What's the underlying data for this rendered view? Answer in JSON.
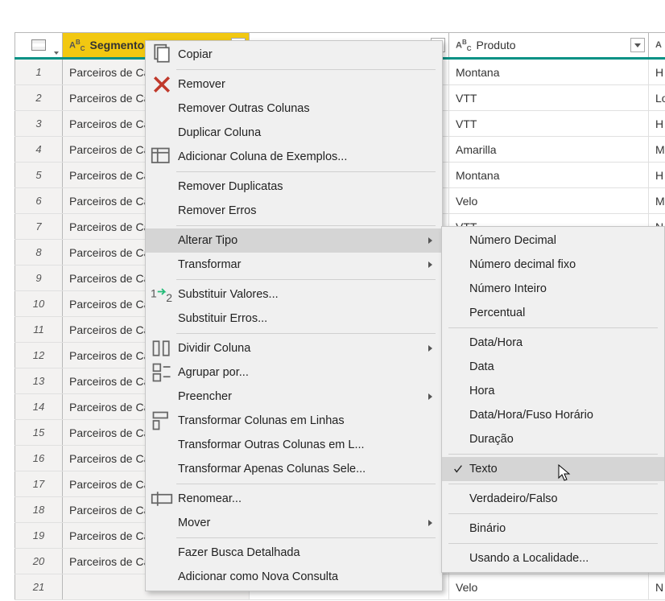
{
  "columns": {
    "segmento": {
      "label": "Segmento",
      "type_prefix": "A",
      "type_suffix": "B",
      "type_sub": "C"
    },
    "pais": {
      "label": "",
      "type_prefix": "A",
      "type_suffix": "B",
      "type_sub": "C"
    },
    "produto": {
      "label": "Produto",
      "type_prefix": "A",
      "type_suffix": "B",
      "type_sub": "C"
    },
    "extra": {
      "label": "",
      "type_prefix": "A"
    }
  },
  "rows": [
    {
      "n": "1",
      "segmento": "Parceiros de Can",
      "produto": "Montana",
      "extra": "H"
    },
    {
      "n": "2",
      "segmento": "Parceiros de Can",
      "produto": "VTT",
      "extra": "Lo"
    },
    {
      "n": "3",
      "segmento": "Parceiros de Can",
      "produto": "VTT",
      "extra": "H"
    },
    {
      "n": "4",
      "segmento": "Parceiros de Can",
      "produto": "Amarilla",
      "extra": "M"
    },
    {
      "n": "5",
      "segmento": "Parceiros de Can",
      "produto": "Montana",
      "extra": "H"
    },
    {
      "n": "6",
      "segmento": "Parceiros de Can",
      "produto": "Velo",
      "extra": "M"
    },
    {
      "n": "7",
      "segmento": "Parceiros de Can",
      "produto": "VTT",
      "extra": "N"
    },
    {
      "n": "8",
      "segmento": "Parceiros de Can",
      "produto": "",
      "extra": ""
    },
    {
      "n": "9",
      "segmento": "Parceiros de Can",
      "produto": "",
      "extra": ""
    },
    {
      "n": "10",
      "segmento": "Parceiros de Can",
      "produto": "",
      "extra": ""
    },
    {
      "n": "11",
      "segmento": "Parceiros de Can",
      "produto": "",
      "extra": ""
    },
    {
      "n": "12",
      "segmento": "Parceiros de Can",
      "produto": "",
      "extra": ""
    },
    {
      "n": "13",
      "segmento": "Parceiros de Can",
      "produto": "",
      "extra": ""
    },
    {
      "n": "14",
      "segmento": "Parceiros de Can",
      "produto": "",
      "extra": ""
    },
    {
      "n": "15",
      "segmento": "Parceiros de Can",
      "produto": "",
      "extra": ""
    },
    {
      "n": "16",
      "segmento": "Parceiros de Can",
      "produto": "",
      "extra": ""
    },
    {
      "n": "17",
      "segmento": "Parceiros de Can",
      "produto": "",
      "extra": ""
    },
    {
      "n": "18",
      "segmento": "Parceiros de Can",
      "produto": "",
      "extra": ""
    },
    {
      "n": "19",
      "segmento": "Parceiros de Can",
      "produto": "",
      "extra": ""
    },
    {
      "n": "20",
      "segmento": "Parceiros de Can",
      "produto": "",
      "extra": ""
    },
    {
      "n": "21",
      "segmento": "",
      "produto": "Velo",
      "extra": "N"
    }
  ],
  "context_menu": {
    "copiar": "Copiar",
    "remover": "Remover",
    "remover_outras": "Remover Outras Colunas",
    "duplicar": "Duplicar Coluna",
    "adicionar_exemplos": "Adicionar Coluna de Exemplos...",
    "remover_duplicatas": "Remover Duplicatas",
    "remover_erros": "Remover Erros",
    "alterar_tipo": "Alterar Tipo",
    "transformar": "Transformar",
    "substituir_valores": "Substituir Valores...",
    "substituir_erros": "Substituir Erros...",
    "dividir_coluna": "Dividir Coluna",
    "agrupar_por": "Agrupar por...",
    "preencher": "Preencher",
    "transformar_linhas": "Transformar Colunas em Linhas",
    "transformar_outras": "Transformar Outras Colunas em L...",
    "transformar_apenas": "Transformar Apenas Colunas Sele...",
    "renomear": "Renomear...",
    "mover": "Mover",
    "busca_detalhada": "Fazer Busca Detalhada",
    "nova_consulta": "Adicionar como Nova Consulta"
  },
  "submenu": {
    "numero_decimal": "Número Decimal",
    "numero_decimal_fixo": "Número decimal fixo",
    "numero_inteiro": "Número Inteiro",
    "percentual": "Percentual",
    "data_hora": "Data/Hora",
    "data": "Data",
    "hora": "Hora",
    "data_hora_fuso": "Data/Hora/Fuso Horário",
    "duracao": "Duração",
    "texto": "Texto",
    "verdadeiro_falso": "Verdadeiro/Falso",
    "binario": "Binário",
    "usando_localidade": "Usando a Localidade..."
  }
}
